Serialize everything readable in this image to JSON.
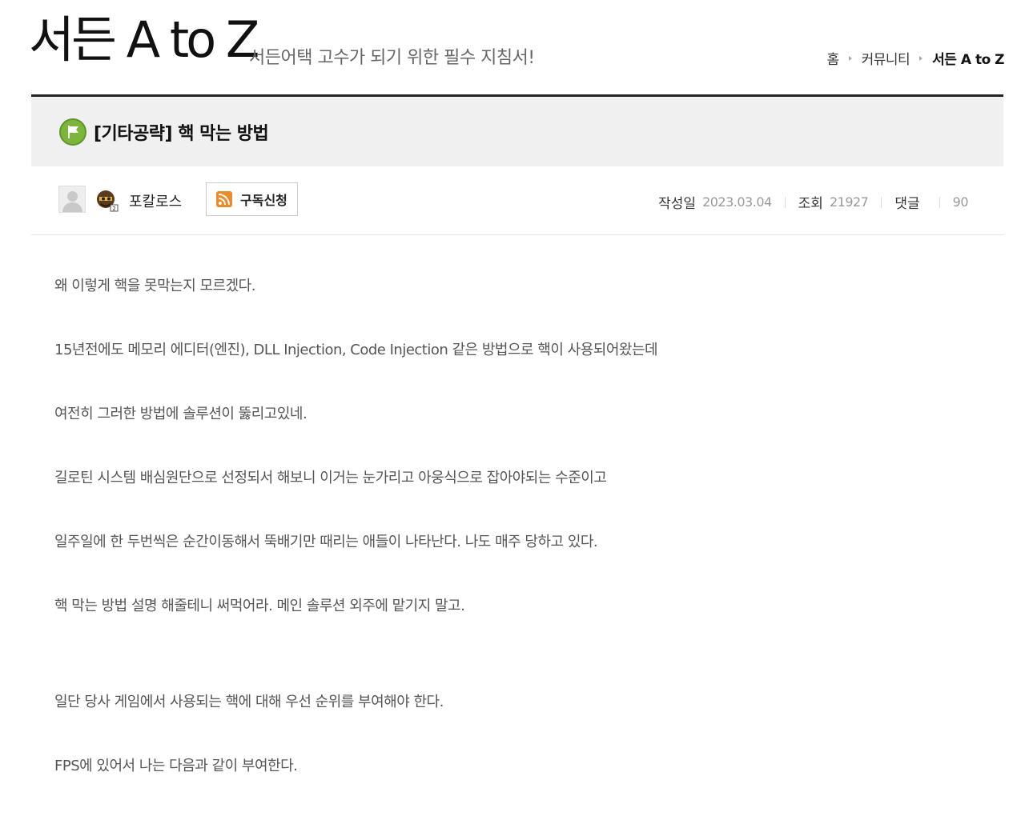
{
  "header": {
    "brand_title": "서든 A to Z",
    "brand_subtitle": "서든어택 고수가 되기 위한 필수 지침서!"
  },
  "breadcrumb": {
    "items": [
      "홈",
      "커뮤니티",
      "서든 A to Z"
    ]
  },
  "post": {
    "title": "[기타공략] 핵 막는 방법",
    "author": "포칼로스",
    "subscribe_label": "구독신청",
    "meta": {
      "date_label": "작성일",
      "date_value": "2023.03.04",
      "views_label": "조회",
      "views_value": "21927",
      "comments_label": "댓글",
      "comments_value": "90"
    },
    "paragraphs": [
      "왜 이렇게 핵을 못막는지 모르겠다.",
      "15년전에도 메모리 에디터(엔진), DLL Injection, Code Injection 같은 방법으로 핵이 사용되어왔는데",
      "여전히 그러한 방법에 솔루션이 뚫리고있네.",
      "길로틴 시스템 배심원단으로 선정되서 해보니 이거는 눈가리고 아웅식으로 잡아야되는 수준이고",
      "일주일에 한 두번씩은 순간이동해서 뚝배기만 때리는 애들이 나타난다. 나도 매주 당하고 있다.",
      "핵 막는 방법 설명 해줄테니 써먹어라. 메인 솔루션 외주에 맡기지 말고.",
      "",
      "일단 당사 게임에서 사용되는 핵에 대해 우선 순위를 부여해야 한다.",
      "FPS에 있어서 나는 다음과 같이 부여한다."
    ]
  },
  "icons": {
    "flag": "flag-icon",
    "rss": "rss-icon",
    "avatar": "default-avatar",
    "level": "level-badge-icon"
  },
  "colors": {
    "flag_green": "#7bb63b",
    "rss_orange": "#f08a24",
    "title_bar_bg": "#f0f0f0"
  }
}
